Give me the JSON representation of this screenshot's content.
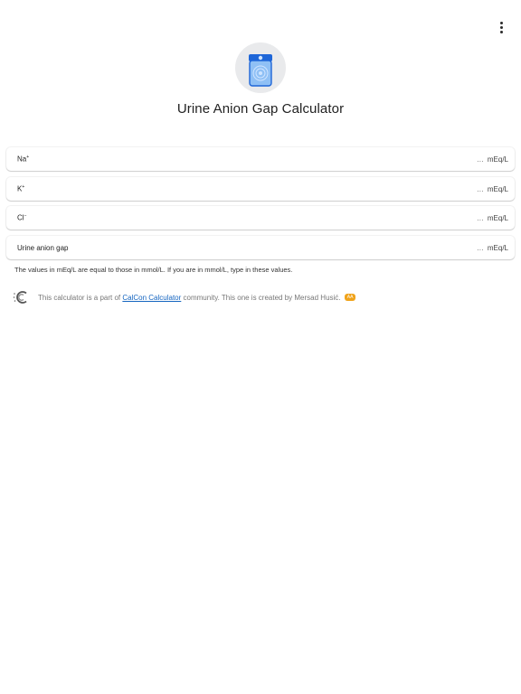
{
  "header": {
    "menu_icon": "more-vert-icon"
  },
  "calculator": {
    "logo_icon": "urine-container-icon",
    "title": "Urine Anion Gap Calculator"
  },
  "fields": [
    {
      "label": "Na",
      "superscript": "+",
      "value": "…",
      "unit": "mEq/L"
    },
    {
      "label": "K",
      "superscript": "+",
      "value": "…",
      "unit": "mEq/L"
    },
    {
      "label": "Cl",
      "superscript": "−",
      "value": "…",
      "unit": "mEq/L"
    },
    {
      "label": "Urine anion gap",
      "superscript": "",
      "value": "…",
      "unit": "mEq/L"
    }
  ],
  "note": "The values in mEq/L are equal to those in mmol/L. If you are in mmol/L, type in these values.",
  "footer": {
    "prefix": "This calculator is a part of ",
    "link": "CalCon Calculator",
    "suffix": " community. This one is created by Mersad Husić.",
    "badge": "AA",
    "logo_icon": "calcon-logo-icon",
    "link_color": "#1565c0",
    "badge_color": "#f0a31b"
  }
}
